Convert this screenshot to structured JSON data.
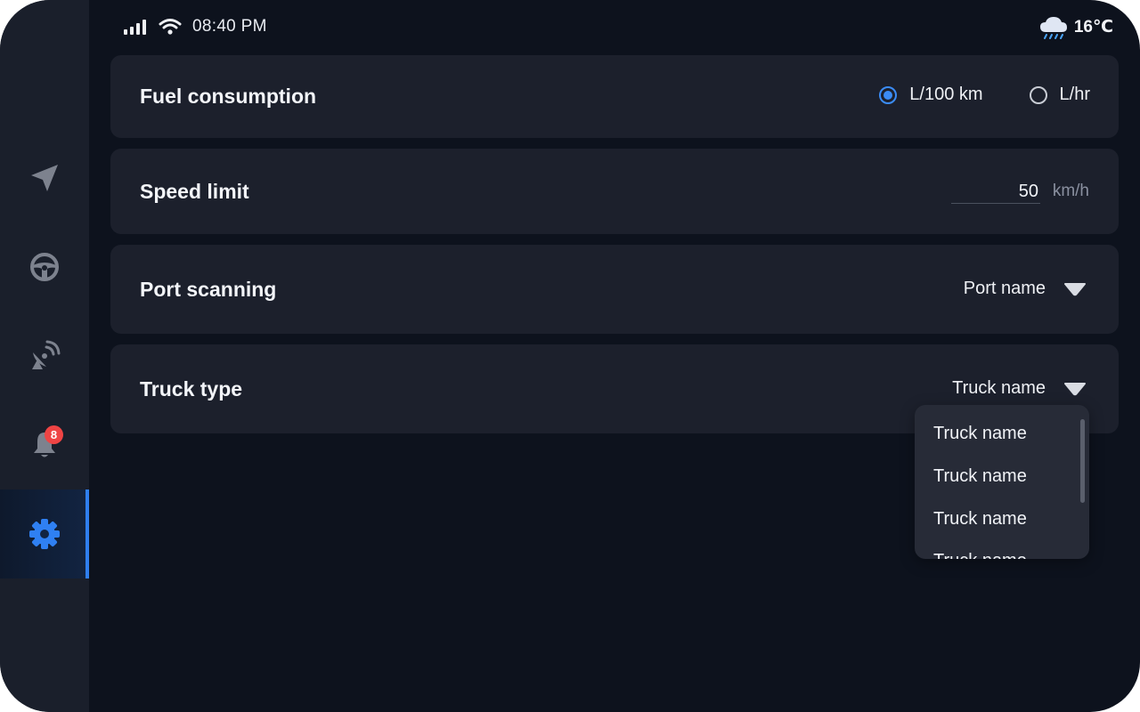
{
  "status_bar": {
    "time": "08:40 PM",
    "temperature": "16℃",
    "icons": [
      "signal-icon",
      "wifi-icon",
      "rain-cloud-icon"
    ]
  },
  "sidebar": {
    "items": [
      {
        "icon": "navigation-arrow-icon",
        "active": false
      },
      {
        "icon": "steering-wheel-icon",
        "active": false
      },
      {
        "icon": "satellite-dish-icon",
        "active": false
      },
      {
        "icon": "bell-icon",
        "active": false,
        "badge": "8"
      },
      {
        "icon": "gear-icon",
        "active": true
      }
    ],
    "active_color": "#2f7ff0"
  },
  "settings": {
    "fuel_consumption": {
      "title": "Fuel consumption",
      "options": [
        {
          "label": "L/100 km",
          "selected": true
        },
        {
          "label": "L/hr",
          "selected": false
        }
      ]
    },
    "speed_limit": {
      "title": "Speed limit",
      "value": "50",
      "unit": "km/h"
    },
    "port_scanning": {
      "title": "Port scanning",
      "selected": "Port name"
    },
    "truck_type": {
      "title": "Truck type",
      "selected": "Truck name",
      "menu_items": [
        "Truck name",
        "Truck name",
        "Truck name",
        "Truck name"
      ]
    }
  },
  "colors": {
    "background": "#0d121d",
    "card": "#1c202c",
    "accent": "#3b8cf6",
    "badge": "#ef4444"
  }
}
